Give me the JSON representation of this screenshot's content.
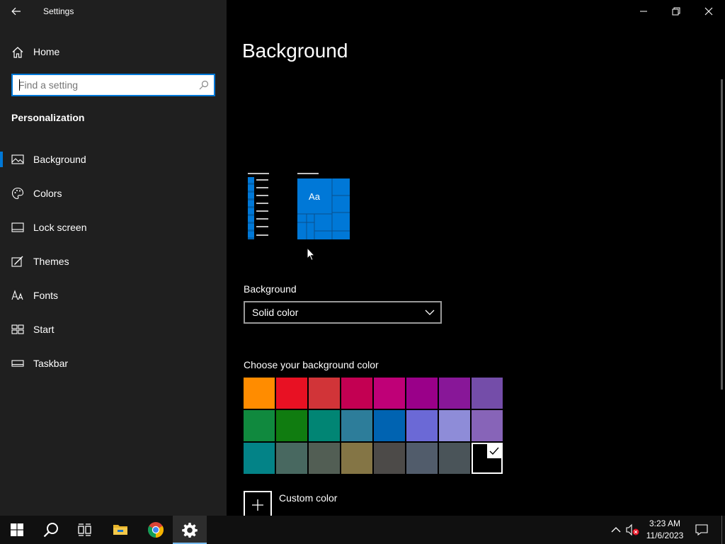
{
  "window": {
    "title": "Settings"
  },
  "sidebar": {
    "home_label": "Home",
    "search": {
      "placeholder": "Find a setting",
      "value": ""
    },
    "section_title": "Personalization",
    "items": [
      {
        "label": "Background",
        "icon": "picture-icon",
        "active": true
      },
      {
        "label": "Colors",
        "icon": "palette-icon",
        "active": false
      },
      {
        "label": "Lock screen",
        "icon": "lock-screen-icon",
        "active": false
      },
      {
        "label": "Themes",
        "icon": "brush-icon",
        "active": false
      },
      {
        "label": "Fonts",
        "icon": "fonts-icon",
        "active": false
      },
      {
        "label": "Start",
        "icon": "start-icon",
        "active": false
      },
      {
        "label": "Taskbar",
        "icon": "taskbar-icon",
        "active": false
      }
    ]
  },
  "main": {
    "title": "Background",
    "preview_tile_text": "Aa",
    "background_label": "Background",
    "background_value": "Solid color",
    "choose_color_label": "Choose your background color",
    "swatches": [
      "#ff8c00",
      "#e81123",
      "#d13438",
      "#c30052",
      "#bf0077",
      "#9a0089",
      "#881798",
      "#744da9",
      "#10893e",
      "#107c10",
      "#018574",
      "#2d7d9a",
      "#0063b1",
      "#6b69d6",
      "#8e8cd8",
      "#8764b8",
      "#038387",
      "#486860",
      "#525e54",
      "#847545",
      "#4c4a48",
      "#515c6b",
      "#4a5459",
      "#000000"
    ],
    "selected_swatch_index": 23,
    "custom_color_label": "Custom color"
  },
  "taskbar": {
    "time": "3:23 AM",
    "date": "11/6/2023",
    "pinned": [
      "windows-start-icon",
      "search-icon",
      "task-view-icon",
      "file-explorer-icon",
      "chrome-icon",
      "settings-gear-icon"
    ]
  },
  "colors": {
    "accent": "#0078d7",
    "sidebar_bg": "#1f1f1f",
    "content_bg": "#000000",
    "taskbar_bg": "#101010"
  }
}
